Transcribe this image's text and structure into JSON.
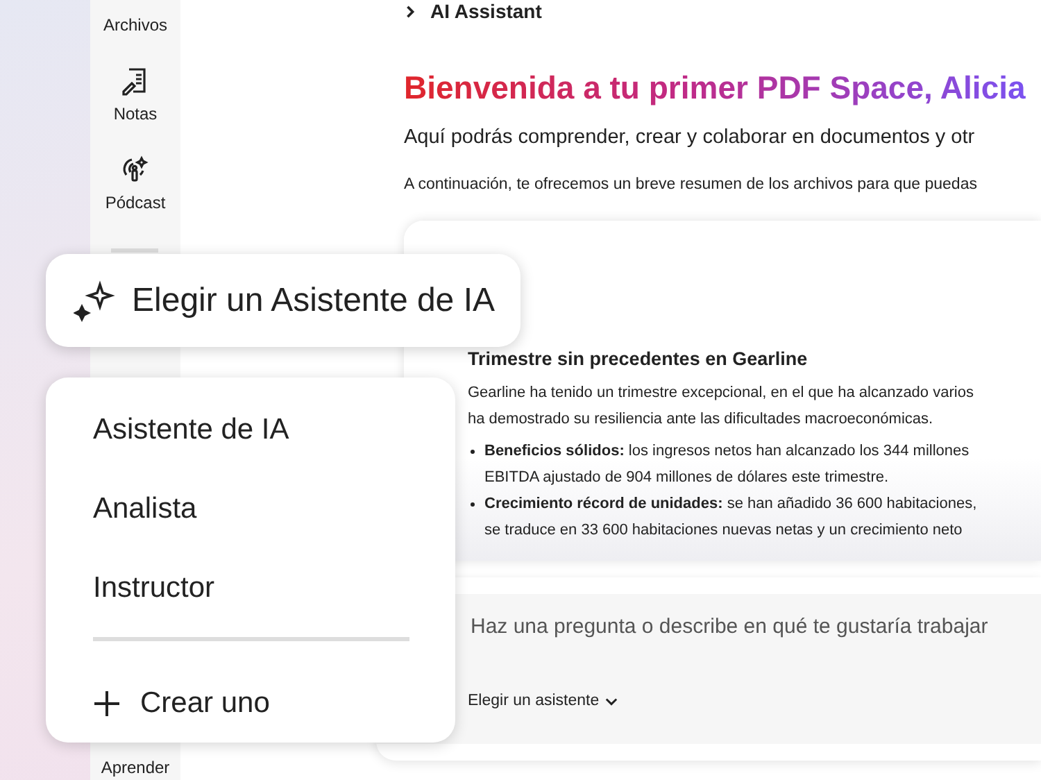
{
  "header": {
    "title": "AI Assistant"
  },
  "sidebar": {
    "items": [
      {
        "kind": "files",
        "label": "Archivos"
      },
      {
        "kind": "notes",
        "label": "Notas"
      },
      {
        "kind": "podcast",
        "label": "Pódcast"
      },
      {
        "kind": "learn",
        "label": "Aprender"
      }
    ]
  },
  "welcome": {
    "title": "Bienvenida a tu primer PDF Space, Alicia",
    "subtitle": "Aquí podrás comprender, crear y colaborar en documentos y otr",
    "intro": "A continuación, te ofrecemos un breve resumen de los archivos para que puedas"
  },
  "summary_card": {
    "heading": "Trimestre sin precedentes en Gearline",
    "paragraph": [
      "Gearline ha tenido un trimestre excepcional, en el que ha alcanzado varios",
      "ha demostrado su resiliencia ante las dificultades macroeconómicas."
    ],
    "bullets": [
      [
        "**Beneficios sólidos:** los ingresos netos han alcanzado los 344 millones",
        "EBITDA ajustado de 904 millones de dólares este trimestre."
      ],
      [
        "**Crecimiento récord de unidades:** se han añadido 36 600 habitaciones,",
        "se traduce en 33 600 habitaciones nuevas netas y un crecimiento neto"
      ]
    ]
  },
  "prompt": {
    "placeholder": "Haz una pregunta o describe en qué te gustaría trabajar",
    "assistant_picker": "Elegir un asistente"
  },
  "assistant_button": {
    "label": "Elegir un Asistente de IA"
  },
  "assistant_menu": {
    "items": [
      "Asistente de IA",
      "Analista",
      "Instructor"
    ],
    "create": "Crear uno"
  }
}
